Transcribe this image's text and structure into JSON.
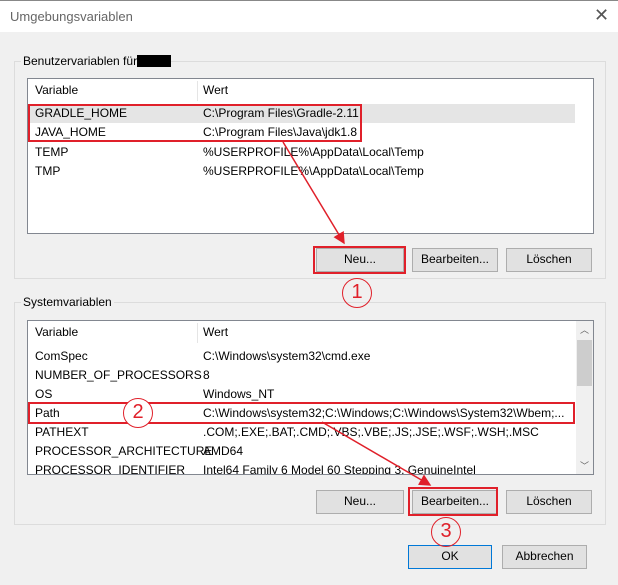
{
  "window": {
    "title": "Umgebungsvariablen"
  },
  "user_group": {
    "label": "Benutzervariablen für",
    "columns": [
      "Variable",
      "Wert"
    ],
    "rows": [
      {
        "variable": "GRADLE_HOME",
        "value": "C:\\Program Files\\Gradle-2.11"
      },
      {
        "variable": "JAVA_HOME",
        "value": "C:\\Program Files\\Java\\jdk1.8"
      },
      {
        "variable": "TEMP",
        "value": "%USERPROFILE%\\AppData\\Local\\Temp"
      },
      {
        "variable": "TMP",
        "value": "%USERPROFILE%\\AppData\\Local\\Temp"
      }
    ],
    "buttons": {
      "new": "Neu...",
      "edit": "Bearbeiten...",
      "delete": "Löschen"
    }
  },
  "system_group": {
    "label": "Systemvariablen",
    "columns": [
      "Variable",
      "Wert"
    ],
    "rows": [
      {
        "variable": "ComSpec",
        "value": "C:\\Windows\\system32\\cmd.exe"
      },
      {
        "variable": "NUMBER_OF_PROCESSORS",
        "value": "8"
      },
      {
        "variable": "OS",
        "value": "Windows_NT"
      },
      {
        "variable": "Path",
        "value": "C:\\Windows\\system32;C:\\Windows;C:\\Windows\\System32\\Wbem;..."
      },
      {
        "variable": "PATHEXT",
        "value": ".COM;.EXE;.BAT;.CMD;.VBS;.VBE;.JS;.JSE;.WSF;.WSH;.MSC"
      },
      {
        "variable": "PROCESSOR_ARCHITECTURE",
        "value": "AMD64"
      },
      {
        "variable": "PROCESSOR_IDENTIFIER",
        "value": "Intel64 Family 6 Model 60 Stepping 3, GenuineIntel"
      }
    ],
    "buttons": {
      "new": "Neu...",
      "edit": "Bearbeiten...",
      "delete": "Löschen"
    }
  },
  "footer": {
    "ok": "OK",
    "cancel": "Abbrechen"
  },
  "annotations": [
    "1",
    "2",
    "3"
  ],
  "colors": {
    "annotation": "#e0202a"
  }
}
